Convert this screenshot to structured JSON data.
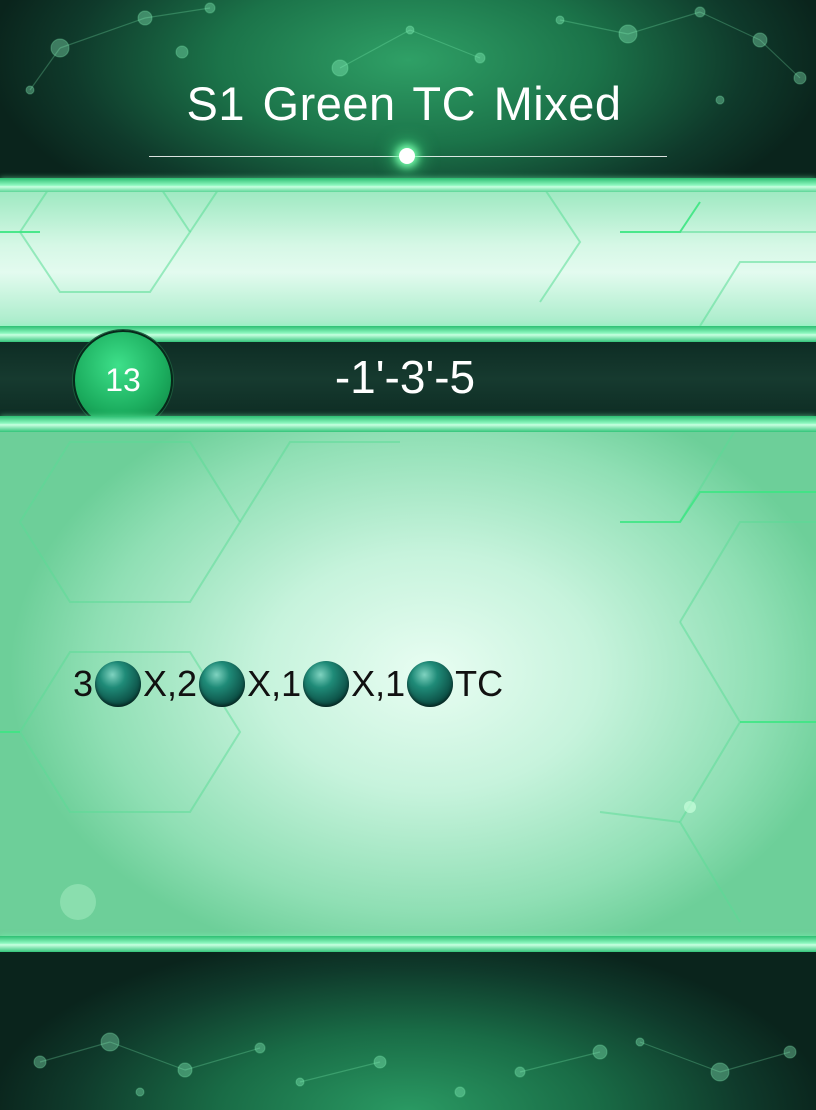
{
  "header": {
    "title": "S1 Green TC Mixed"
  },
  "band": {
    "badge_number": "13",
    "value": "-1'-3'-5"
  },
  "formula": {
    "segments": [
      "3",
      "X,2",
      "X,1",
      "X,1",
      "TC"
    ],
    "ball_icon": "dark-teal-ball-icon"
  },
  "colors": {
    "accent_green": "#2dbf73",
    "dark_band": "#0e2d24",
    "ball": "#0c4f45"
  }
}
